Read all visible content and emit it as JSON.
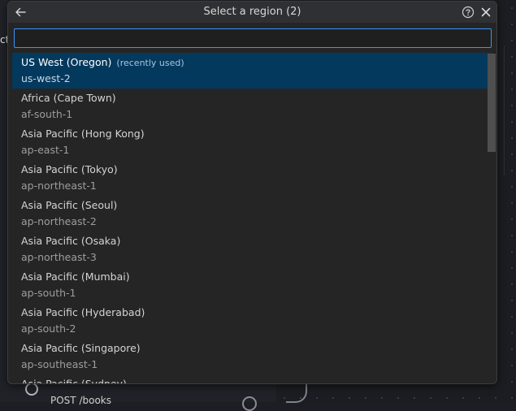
{
  "background": {
    "tab_fragment": "ct",
    "node_label": "POST /books"
  },
  "quickpick": {
    "title": "Select a region (2)",
    "input_value": "",
    "input_placeholder": "",
    "items": [
      {
        "label": "US West (Oregon)",
        "note": "(recently used)",
        "description": "us-west-2",
        "selected": true
      },
      {
        "label": "Africa (Cape Town)",
        "note": "",
        "description": "af-south-1",
        "selected": false
      },
      {
        "label": "Asia Pacific (Hong Kong)",
        "note": "",
        "description": "ap-east-1",
        "selected": false
      },
      {
        "label": "Asia Pacific (Tokyo)",
        "note": "",
        "description": "ap-northeast-1",
        "selected": false
      },
      {
        "label": "Asia Pacific (Seoul)",
        "note": "",
        "description": "ap-northeast-2",
        "selected": false
      },
      {
        "label": "Asia Pacific (Osaka)",
        "note": "",
        "description": "ap-northeast-3",
        "selected": false
      },
      {
        "label": "Asia Pacific (Mumbai)",
        "note": "",
        "description": "ap-south-1",
        "selected": false
      },
      {
        "label": "Asia Pacific (Hyderabad)",
        "note": "",
        "description": "ap-south-2",
        "selected": false
      },
      {
        "label": "Asia Pacific (Singapore)",
        "note": "",
        "description": "ap-southeast-1",
        "selected": false
      },
      {
        "label": "Asia Pacific (Sydney)",
        "note": "",
        "description": "",
        "selected": false
      }
    ],
    "icons": {
      "back": "arrow-left-icon",
      "help": "question-circle-icon",
      "close": "close-icon"
    },
    "colors": {
      "selected_background": "#04395e",
      "input_focus_border": "#3794ff"
    }
  }
}
